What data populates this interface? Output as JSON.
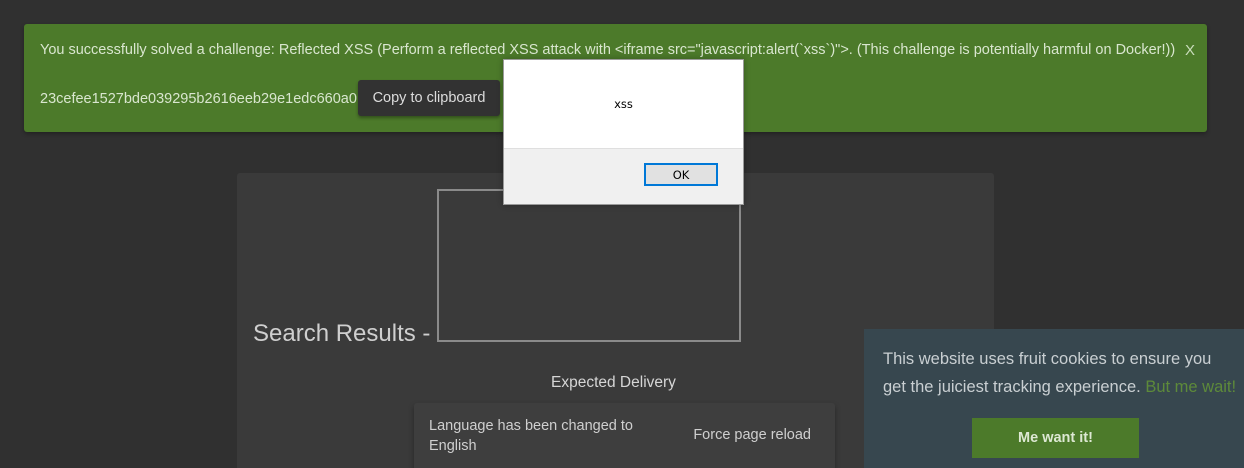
{
  "banner": {
    "message": "You successfully solved a challenge: Reflected XSS (Perform a reflected XSS attack with <iframe src=\"javascript:alert(`xss`)\">. (This challenge is potentially harmful on Docker!))",
    "close_label": "X",
    "code": "23cefee1527bde039295b2616eeb29e1edc660a0",
    "copy_label": "Copy to clipboard"
  },
  "main": {
    "search_title": "Search Results -",
    "column_header": "Expected Delivery"
  },
  "snackbar": {
    "message": "Language has been changed to English",
    "action_label": "Force page reload"
  },
  "cookie": {
    "message": "This website uses fruit cookies to ensure you get the juiciest tracking experience.",
    "link_label": "But me wait!",
    "accept_label": "Me want it!"
  },
  "alert": {
    "text": "xss",
    "ok_label": "OK"
  },
  "colors": {
    "banner_bg": "#4c7a2a",
    "page_bg": "#303030",
    "card_bg": "#3a3a3a",
    "cookie_bg": "#37474f",
    "accent_focus": "#0078d7"
  }
}
